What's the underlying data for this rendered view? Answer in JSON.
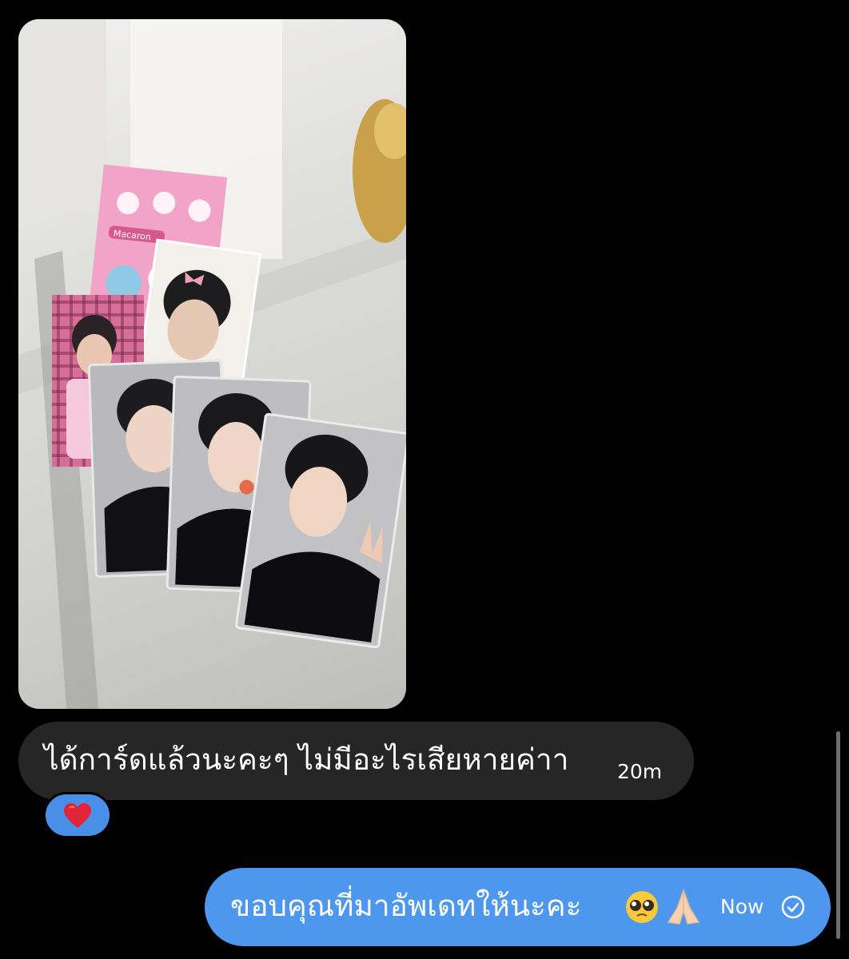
{
  "conversation": {
    "incoming_message": {
      "text": "ได้การ์ดแล้วนะคะๆ ไม่มีอะไรเสียหายค่าา",
      "time": "20m",
      "reaction_icon": "red-heart"
    },
    "outgoing_message": {
      "text": "ขอบคุณที่มาอัพเดทให้นะคะ",
      "emojis": [
        "pleading-face",
        "folded-hands"
      ],
      "time": "Now",
      "status_icon": "seen-check"
    },
    "shared_photo": {
      "description_icon": "photocards-photo",
      "sticker_text": "Macaron"
    }
  },
  "colors": {
    "background": "#000000",
    "incoming_bubble": "#262626",
    "outgoing_bubble": "#4d97ee",
    "reaction_bubble": "#4a8fe7"
  }
}
